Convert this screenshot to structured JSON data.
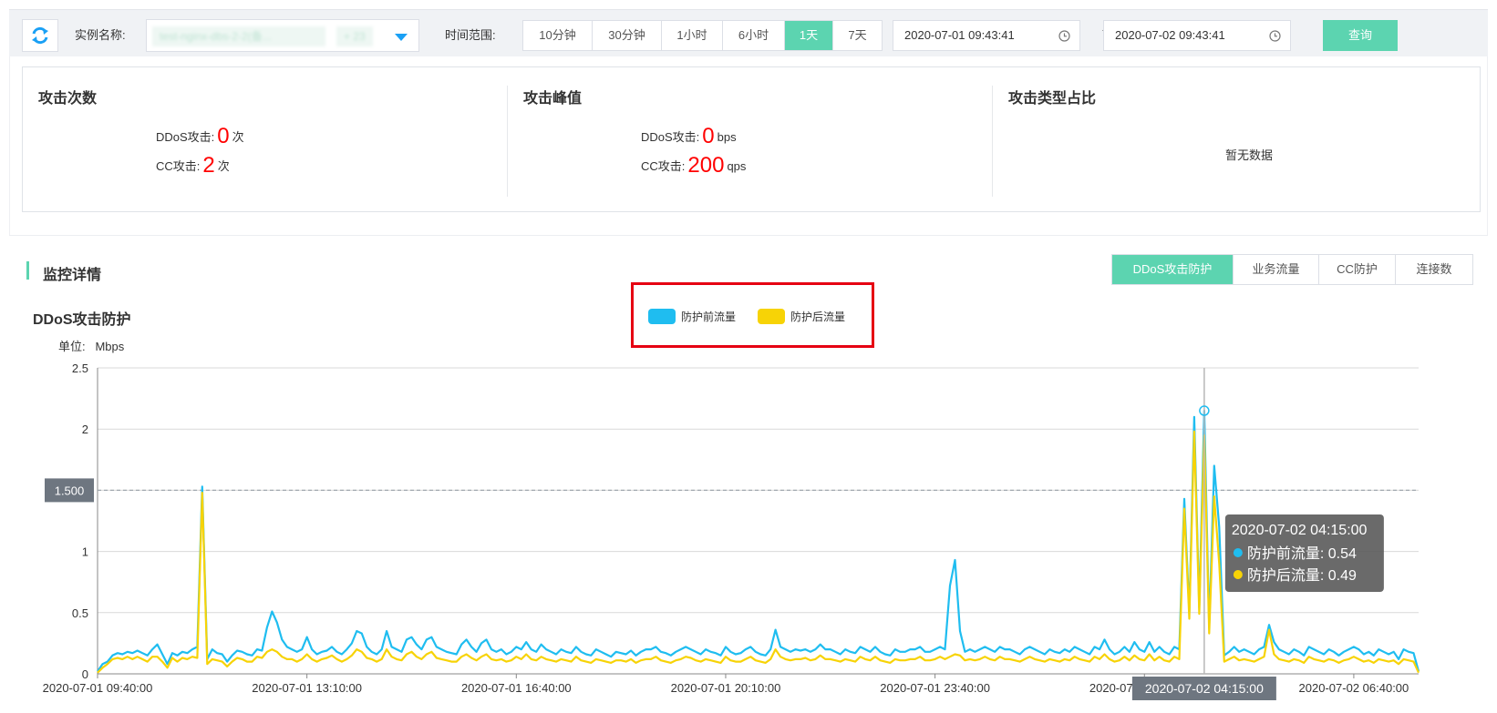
{
  "toolbar": {
    "instance_label": "实例名称:",
    "instance_tags": [
      "test-nginx-dbs-2-2(备...",
      "+ 23"
    ],
    "time_label": "时间范围:",
    "time_ranges": [
      "10分钟",
      "30分钟",
      "1小时",
      "6小时",
      "1天",
      "7天"
    ],
    "active_range": "1天",
    "start_time": "2020-07-01 09:43:41",
    "end_time": "2020-07-02 09:43:41",
    "date_separator": "-",
    "query_label": "查询"
  },
  "stats": {
    "count": {
      "title": "攻击次数",
      "ddos_label": "DDoS攻击:",
      "ddos_value": "0",
      "ddos_unit": "次",
      "cc_label": "CC攻击:",
      "cc_value": "2",
      "cc_unit": "次"
    },
    "peak": {
      "title": "攻击峰值",
      "ddos_label": "DDoS攻击:",
      "ddos_value": "0",
      "ddos_unit": "bps",
      "cc_label": "CC攻击:",
      "cc_value": "200",
      "cc_unit": "qps"
    },
    "types": {
      "title": "攻击类型占比",
      "empty_text": "暂无数据"
    }
  },
  "monitor": {
    "title": "监控详情",
    "tabs": [
      "DDoS攻击防护",
      "业务流量",
      "CC防护",
      "连接数"
    ],
    "active_tab": "DDoS攻击防护"
  },
  "colors": {
    "accent": "#5cd4b0",
    "series_before": "#1fbdf0",
    "series_after": "#f7d306",
    "highlight_red": "#ff0000"
  },
  "chart_data": {
    "type": "line",
    "title": "DDoS攻击防护",
    "unit_label": "单位:",
    "unit": "Mbps",
    "ylim": [
      0,
      2.5
    ],
    "y_ticks": [
      "0",
      "0.5",
      "1",
      "1.5",
      "2",
      "2.5"
    ],
    "x_tick_labels": [
      "2020-07-01 09:40:00",
      "2020-07-01 13:10:00",
      "2020-07-01 16:40:00",
      "2020-07-01 20:10:00",
      "2020-07-01 23:40:00",
      "2020-07-02 03:10:00",
      "2020-07-02 06:40:00"
    ],
    "grid": true,
    "legend": "top-center",
    "reference_line": {
      "value": 1.5,
      "label": "1.500"
    },
    "crosshair": {
      "x_label": "2020-07-02 04:15:00",
      "x_index": 222
    },
    "tooltip": {
      "time": "2020-07-02 04:15:00",
      "before_label": "防护前流量: 0.54",
      "after_label": "防护后流量: 0.49"
    },
    "sample_interval_minutes": 5,
    "series": [
      {
        "name": "防护前流量",
        "values": [
          0.02,
          0.08,
          0.1,
          0.15,
          0.17,
          0.16,
          0.18,
          0.17,
          0.19,
          0.17,
          0.15,
          0.2,
          0.24,
          0.16,
          0.08,
          0.17,
          0.15,
          0.18,
          0.17,
          0.2,
          0.22,
          1.53,
          0.12,
          0.2,
          0.17,
          0.16,
          0.1,
          0.15,
          0.19,
          0.18,
          0.16,
          0.15,
          0.2,
          0.19,
          0.38,
          0.51,
          0.42,
          0.28,
          0.22,
          0.2,
          0.18,
          0.2,
          0.3,
          0.2,
          0.16,
          0.18,
          0.19,
          0.22,
          0.18,
          0.16,
          0.2,
          0.25,
          0.35,
          0.33,
          0.22,
          0.18,
          0.16,
          0.2,
          0.35,
          0.22,
          0.2,
          0.18,
          0.28,
          0.3,
          0.24,
          0.2,
          0.28,
          0.3,
          0.22,
          0.2,
          0.18,
          0.17,
          0.16,
          0.24,
          0.28,
          0.22,
          0.18,
          0.25,
          0.28,
          0.2,
          0.18,
          0.2,
          0.16,
          0.18,
          0.22,
          0.2,
          0.26,
          0.2,
          0.18,
          0.24,
          0.2,
          0.18,
          0.16,
          0.2,
          0.18,
          0.17,
          0.22,
          0.18,
          0.16,
          0.15,
          0.2,
          0.18,
          0.16,
          0.14,
          0.18,
          0.17,
          0.16,
          0.19,
          0.15,
          0.18,
          0.2,
          0.2,
          0.22,
          0.18,
          0.17,
          0.15,
          0.18,
          0.2,
          0.22,
          0.2,
          0.18,
          0.16,
          0.2,
          0.18,
          0.17,
          0.15,
          0.22,
          0.18,
          0.16,
          0.17,
          0.2,
          0.22,
          0.18,
          0.16,
          0.15,
          0.2,
          0.36,
          0.22,
          0.2,
          0.18,
          0.2,
          0.19,
          0.2,
          0.18,
          0.2,
          0.24,
          0.2,
          0.2,
          0.18,
          0.16,
          0.2,
          0.18,
          0.17,
          0.22,
          0.2,
          0.18,
          0.22,
          0.18,
          0.16,
          0.15,
          0.2,
          0.18,
          0.18,
          0.2,
          0.2,
          0.22,
          0.18,
          0.18,
          0.2,
          0.22,
          0.2,
          0.72,
          0.93,
          0.35,
          0.18,
          0.2,
          0.18,
          0.2,
          0.22,
          0.2,
          0.18,
          0.22,
          0.2,
          0.2,
          0.18,
          0.16,
          0.2,
          0.22,
          0.2,
          0.18,
          0.16,
          0.2,
          0.18,
          0.17,
          0.2,
          0.18,
          0.22,
          0.2,
          0.18,
          0.16,
          0.22,
          0.2,
          0.28,
          0.2,
          0.16,
          0.18,
          0.22,
          0.18,
          0.26,
          0.2,
          0.18,
          0.26,
          0.18,
          0.22,
          0.18,
          0.16,
          0.22,
          0.2,
          1.43,
          0.5,
          2.1,
          0.54,
          2.15,
          0.38,
          1.7,
          1.2,
          0.15,
          0.18,
          0.22,
          0.18,
          0.2,
          0.18,
          0.16,
          0.2,
          0.22,
          0.4,
          0.26,
          0.2,
          0.18,
          0.16,
          0.2,
          0.18,
          0.15,
          0.22,
          0.2,
          0.18,
          0.16,
          0.2,
          0.18,
          0.15,
          0.18,
          0.2,
          0.22,
          0.2,
          0.16,
          0.18,
          0.15,
          0.2,
          0.18,
          0.16,
          0.18,
          0.12,
          0.2,
          0.18,
          0.17,
          0.02
        ]
      },
      {
        "name": "防护后流量",
        "values": [
          0.01,
          0.05,
          0.08,
          0.12,
          0.13,
          0.12,
          0.14,
          0.12,
          0.14,
          0.12,
          0.1,
          0.14,
          0.14,
          0.1,
          0.05,
          0.13,
          0.1,
          0.13,
          0.12,
          0.14,
          0.13,
          1.48,
          0.08,
          0.12,
          0.11,
          0.1,
          0.06,
          0.1,
          0.13,
          0.12,
          0.1,
          0.1,
          0.14,
          0.13,
          0.18,
          0.2,
          0.18,
          0.14,
          0.12,
          0.12,
          0.1,
          0.12,
          0.16,
          0.12,
          0.1,
          0.12,
          0.13,
          0.15,
          0.12,
          0.1,
          0.12,
          0.15,
          0.2,
          0.18,
          0.13,
          0.12,
          0.1,
          0.12,
          0.2,
          0.14,
          0.12,
          0.11,
          0.16,
          0.18,
          0.14,
          0.12,
          0.16,
          0.18,
          0.13,
          0.12,
          0.11,
          0.1,
          0.1,
          0.14,
          0.16,
          0.13,
          0.11,
          0.14,
          0.16,
          0.12,
          0.11,
          0.12,
          0.1,
          0.11,
          0.14,
          0.12,
          0.16,
          0.12,
          0.11,
          0.14,
          0.12,
          0.11,
          0.1,
          0.12,
          0.11,
          0.1,
          0.14,
          0.11,
          0.1,
          0.09,
          0.12,
          0.11,
          0.1,
          0.09,
          0.11,
          0.11,
          0.1,
          0.12,
          0.09,
          0.11,
          0.12,
          0.12,
          0.14,
          0.11,
          0.1,
          0.09,
          0.11,
          0.12,
          0.14,
          0.13,
          0.11,
          0.1,
          0.12,
          0.11,
          0.1,
          0.09,
          0.14,
          0.11,
          0.1,
          0.1,
          0.12,
          0.14,
          0.11,
          0.1,
          0.09,
          0.12,
          0.2,
          0.14,
          0.12,
          0.11,
          0.12,
          0.12,
          0.13,
          0.11,
          0.12,
          0.15,
          0.12,
          0.12,
          0.11,
          0.1,
          0.12,
          0.11,
          0.1,
          0.14,
          0.12,
          0.11,
          0.14,
          0.11,
          0.1,
          0.09,
          0.12,
          0.11,
          0.11,
          0.12,
          0.12,
          0.14,
          0.11,
          0.11,
          0.12,
          0.14,
          0.12,
          0.14,
          0.16,
          0.15,
          0.11,
          0.12,
          0.11,
          0.12,
          0.14,
          0.12,
          0.11,
          0.14,
          0.12,
          0.12,
          0.11,
          0.1,
          0.12,
          0.14,
          0.12,
          0.11,
          0.1,
          0.12,
          0.11,
          0.1,
          0.12,
          0.11,
          0.14,
          0.12,
          0.11,
          0.1,
          0.14,
          0.12,
          0.16,
          0.12,
          0.1,
          0.11,
          0.14,
          0.11,
          0.15,
          0.12,
          0.11,
          0.16,
          0.11,
          0.14,
          0.11,
          0.1,
          0.14,
          0.12,
          1.35,
          0.45,
          1.98,
          0.49,
          1.95,
          0.33,
          1.45,
          0.9,
          0.1,
          0.12,
          0.14,
          0.11,
          0.12,
          0.11,
          0.1,
          0.12,
          0.14,
          0.36,
          0.16,
          0.12,
          0.11,
          0.1,
          0.12,
          0.11,
          0.09,
          0.14,
          0.12,
          0.11,
          0.1,
          0.12,
          0.11,
          0.09,
          0.11,
          0.12,
          0.14,
          0.12,
          0.1,
          0.11,
          0.09,
          0.12,
          0.11,
          0.1,
          0.11,
          0.08,
          0.12,
          0.11,
          0.1,
          0.01
        ]
      }
    ]
  }
}
